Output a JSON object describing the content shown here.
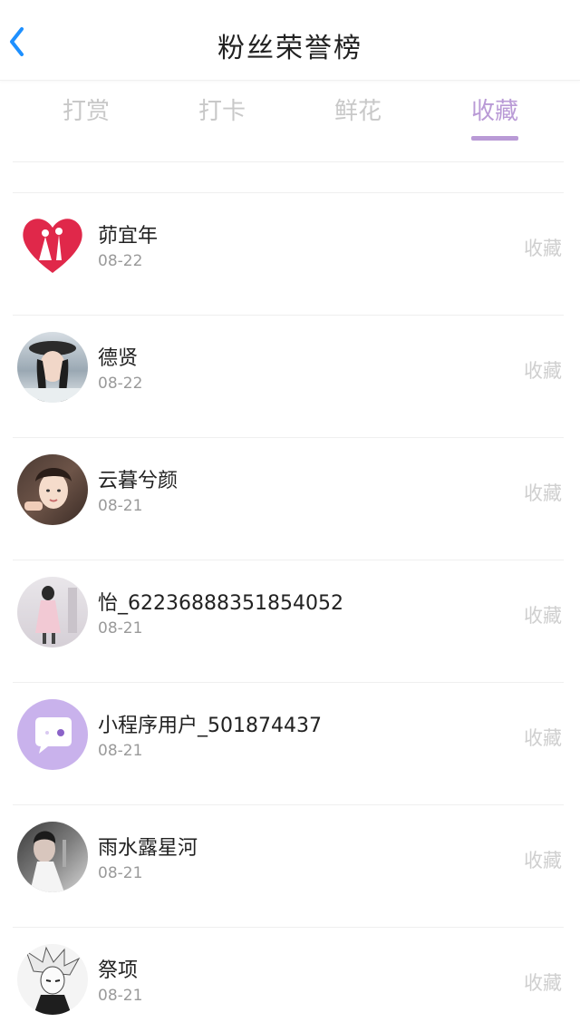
{
  "header": {
    "title": "粉丝荣誉榜",
    "back_icon": "chevron-left-icon",
    "back_color": "#1e90ff"
  },
  "tabs": [
    {
      "label": "打赏",
      "active": false
    },
    {
      "label": "打卡",
      "active": false
    },
    {
      "label": "鲜花",
      "active": false
    },
    {
      "label": "收藏",
      "active": true
    }
  ],
  "accent_color": "#b99ad6",
  "fans": [
    {
      "name": "茆宜年",
      "date": "08-22",
      "action": "收藏",
      "avatar": "heart-couple"
    },
    {
      "name": "德贤",
      "date": "08-22",
      "action": "收藏",
      "avatar": "girl-photo"
    },
    {
      "name": "云暮兮颜",
      "date": "08-21",
      "action": "收藏",
      "avatar": "girl-photo-2"
    },
    {
      "name": "怡_6223688835185405​2",
      "date": "08-21",
      "action": "收藏",
      "avatar": "girl-photo-3"
    },
    {
      "name": "小程序用户_501874437",
      "date": "08-21",
      "action": "收藏",
      "avatar": "chat-bubble-icon"
    },
    {
      "name": "雨水露星河",
      "date": "08-21",
      "action": "收藏",
      "avatar": "girl-photo-4"
    },
    {
      "name": "祭项",
      "date": "08-21",
      "action": "收藏",
      "avatar": "anime-boy"
    }
  ]
}
